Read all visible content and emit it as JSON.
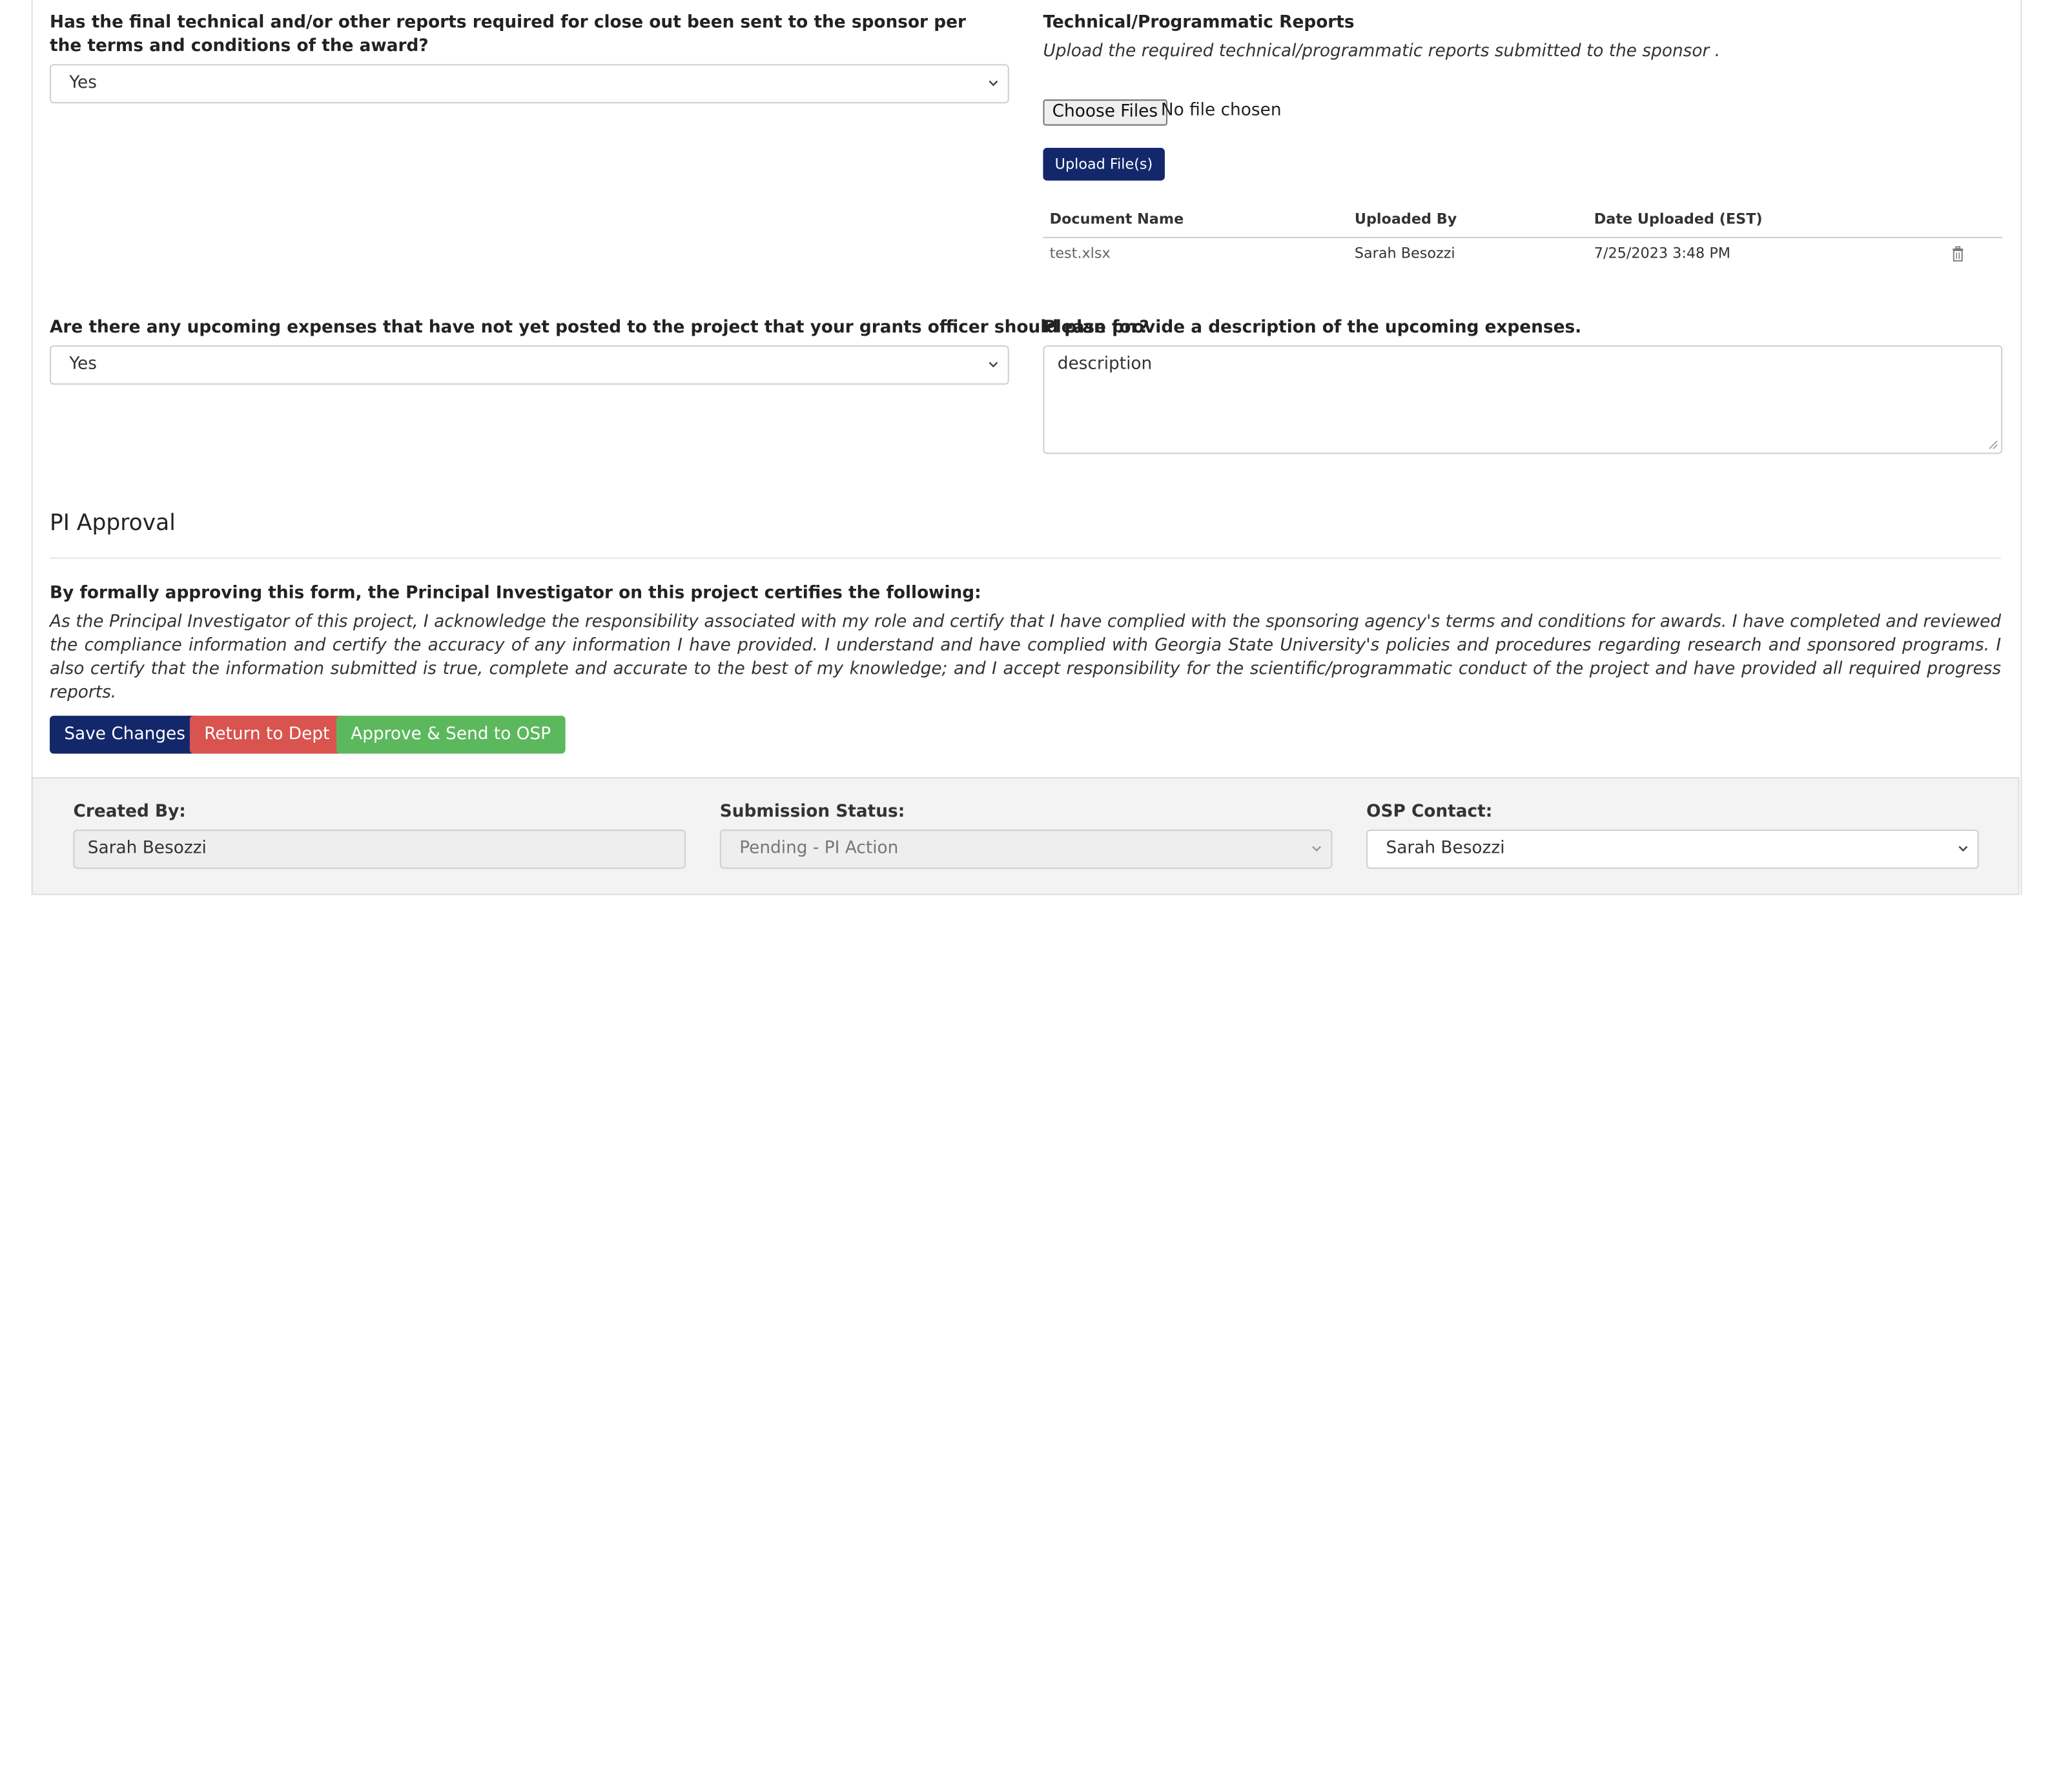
{
  "reports_question": {
    "label": "Has the final technical and/or other reports required for close out been sent to the sponsor per the terms and conditions of the award?",
    "selected": "Yes"
  },
  "tech_reports": {
    "title": "Technical/Programmatic Reports",
    "note": "Upload the required technical/programmatic reports submitted to the sponsor .",
    "choose_files_label": "Choose Files",
    "no_file_text": "No file chosen",
    "upload_label": "Upload File(s)",
    "columns": [
      "Document Name",
      "Uploaded By",
      "Date Uploaded (EST)"
    ],
    "rows": [
      {
        "document_name": "test.xlsx",
        "uploaded_by": "Sarah Besozzi",
        "date_uploaded": "7/25/2023 3:48 PM"
      }
    ]
  },
  "expenses_question": {
    "label": "Are there any upcoming expenses that have not yet posted to the project that your grants officer should plan for?",
    "selected": "Yes"
  },
  "expenses_description": {
    "label": "Please provide a description of the upcoming expenses.",
    "value": "description"
  },
  "pi_approval": {
    "title": "PI Approval",
    "cert_heading": "By formally approving this form, the Principal Investigator on this project certifies the following:",
    "cert_text": "As the Principal Investigator of this project, I acknowledge the responsibility associated with my role and certify that I have complied with the sponsoring agency's terms and conditions for awards. I have completed and reviewed the compliance information and certify the accuracy of any information I have provided. I understand and have complied with Georgia State University's policies and procedures regarding research and sponsored programs. I also certify that the information submitted is true, complete and accurate to the best of my knowledge; and I accept responsibility for the scientific/programmatic conduct of the project and have provided all required progress reports."
  },
  "actions": {
    "save_label": "Save Changes",
    "return_label": "Return to Dept",
    "approve_label": "Approve & Send to OSP"
  },
  "footer": {
    "created_by_label": "Created By:",
    "created_by_value": "Sarah Besozzi",
    "status_label": "Submission Status:",
    "status_value": "Pending - PI Action",
    "osp_label": "OSP Contact:",
    "osp_value": "Sarah Besozzi"
  },
  "colors": {
    "primary": "#13286b",
    "danger": "#d9534f",
    "success": "#5cb85c"
  }
}
